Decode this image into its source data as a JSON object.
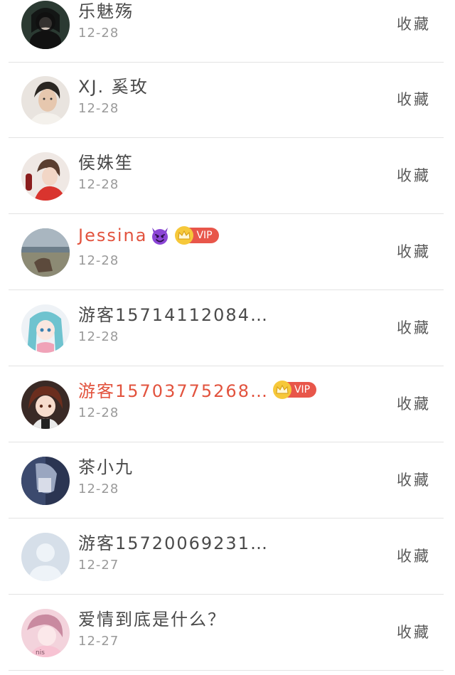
{
  "items": [
    {
      "name": "乐魅殇",
      "date": "12-28",
      "action": "收藏",
      "red": false,
      "vip": false,
      "emoji": false,
      "avatar": "avatar-dark-woman"
    },
    {
      "name": "XJ. 奚玫",
      "date": "12-28",
      "action": "收藏",
      "red": false,
      "vip": false,
      "emoji": false,
      "avatar": "avatar-man-portrait"
    },
    {
      "name": "侯姝笙",
      "date": "12-28",
      "action": "收藏",
      "red": false,
      "vip": false,
      "emoji": false,
      "avatar": "avatar-girl-red"
    },
    {
      "name": "Jessina",
      "date": "12-28",
      "action": "收藏",
      "red": true,
      "vip": true,
      "vip_label": "VIP",
      "emoji": true,
      "avatar": "avatar-landscape"
    },
    {
      "name": "游客15714112084…",
      "date": "12-28",
      "action": "收藏",
      "red": false,
      "vip": false,
      "emoji": false,
      "avatar": "avatar-anime-blue"
    },
    {
      "name": "游客15703775268…",
      "date": "12-28",
      "action": "收藏",
      "red": true,
      "vip": true,
      "vip_label": "VIP",
      "emoji": false,
      "avatar": "avatar-anime-girl"
    },
    {
      "name": "茶小九",
      "date": "12-28",
      "action": "收藏",
      "red": false,
      "vip": false,
      "emoji": false,
      "avatar": "avatar-blue-photo"
    },
    {
      "name": "游客15720069231…",
      "date": "12-27",
      "action": "收藏",
      "red": false,
      "vip": false,
      "emoji": false,
      "avatar": "avatar-default-person"
    },
    {
      "name": "爱情到底是什么？",
      "date": "12-27",
      "action": "收藏",
      "red": false,
      "vip": false,
      "emoji": false,
      "avatar": "avatar-pink-girl"
    }
  ],
  "colors": {
    "name": "#4a4a4a",
    "name_vip": "#e2533e",
    "date": "#9a9a9a",
    "vip_tag": "#e8564a",
    "vip_crown": "#f6c83a",
    "separator": "#e3e3e3"
  }
}
